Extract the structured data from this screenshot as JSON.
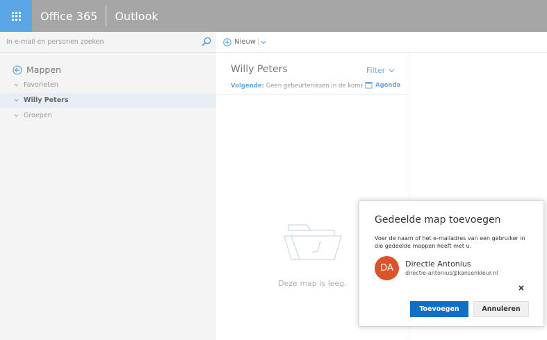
{
  "topbar": {
    "brand": "Office 365",
    "app_name": "Outlook",
    "accent": "#5aa5e6",
    "bar_color": "#a6a6a6"
  },
  "search": {
    "placeholder": "In e-mail en personen zoeken"
  },
  "commands": {
    "new_label": "Nieuw"
  },
  "sidebar": {
    "header": "Mappen",
    "items": [
      {
        "label": "Favorieten",
        "selected": false
      },
      {
        "label": "Willy Peters",
        "selected": true
      },
      {
        "label": "Groepen",
        "selected": false
      }
    ]
  },
  "message_list": {
    "title": "Willy Peters",
    "filter_label": "Filter",
    "next_label": "Volgende:",
    "next_text": "Geen gebeurtenissen in de komen",
    "agenda_label": "Agenda",
    "empty_text": "Deze map is leeg."
  },
  "dialog": {
    "title": "Gedeelde map toevoegen",
    "description": "Voer de naam of het e-mailadres van een gebruiker in die gedeelde mappen heeft met u.",
    "person": {
      "initials": "DA",
      "name": "Directie Antonius",
      "email": "directie-antonius@kansenkleur.nl",
      "avatar_color": "#d9542b"
    },
    "add_label": "Toevoegen",
    "cancel_label": "Annuleren",
    "primary_color": "#0f6fc6"
  }
}
